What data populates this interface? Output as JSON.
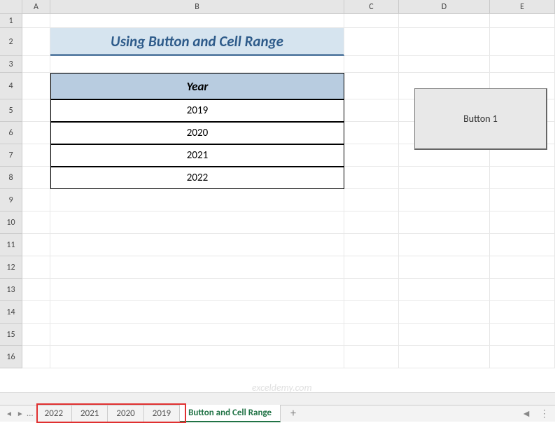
{
  "columns": {
    "A": "A",
    "B": "B",
    "C": "C",
    "D": "D",
    "E": "E"
  },
  "rows": [
    "1",
    "2",
    "3",
    "4",
    "5",
    "6",
    "7",
    "8",
    "9",
    "10",
    "11",
    "12",
    "13",
    "14",
    "15",
    "16"
  ],
  "title": "Using Button and Cell Range",
  "table": {
    "header": "Year",
    "values": [
      "2019",
      "2020",
      "2021",
      "2022"
    ]
  },
  "button": {
    "label": "Button 1"
  },
  "watermark": "exceldemy.com",
  "tabs": {
    "items": [
      "2022",
      "2021",
      "2020",
      "2019"
    ],
    "active": "Button and Cell Range",
    "add": "+",
    "ellipsis": "..."
  },
  "nav": {
    "left": "◄",
    "right": "►"
  }
}
